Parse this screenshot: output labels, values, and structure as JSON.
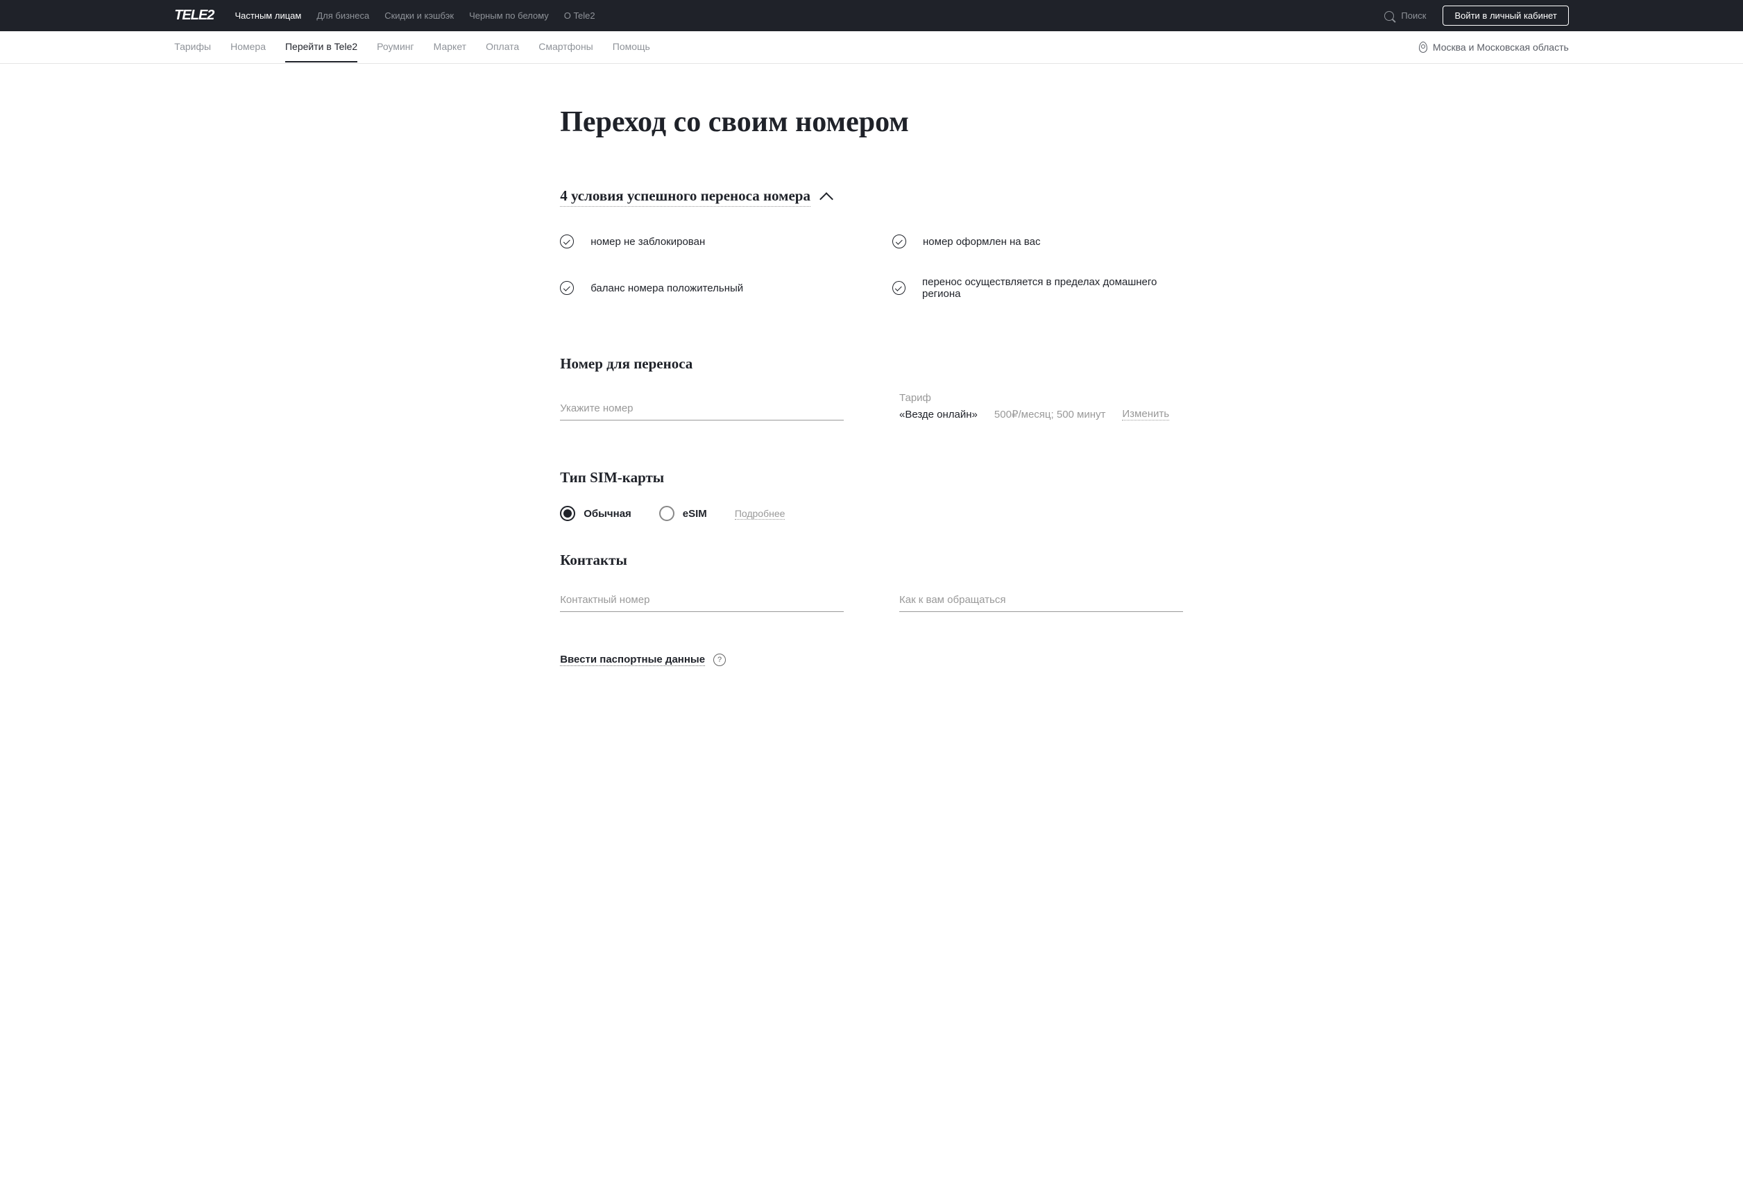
{
  "header": {
    "logo": "TELE2",
    "top_nav": [
      "Частным лицам",
      "Для бизнеса",
      "Скидки и кэшбэк",
      "Черным по белому",
      "О Tele2"
    ],
    "top_nav_active": 0,
    "search_label": "Поиск",
    "login_label": "Войти в личный кабинет"
  },
  "nav": {
    "items": [
      "Тарифы",
      "Номера",
      "Перейти в Tele2",
      "Роуминг",
      "Маркет",
      "Оплата",
      "Смартфоны",
      "Помощь"
    ],
    "active": 2,
    "region": "Москва и Московская область"
  },
  "page": {
    "title": "Переход со своим номером",
    "conditions_header": "4 условия успешного переноса номера",
    "conditions": [
      "номер не заблокирован",
      "номер оформлен на вас",
      "баланс номера положительный",
      "перенос осуществляется в пределах домашнего региона"
    ]
  },
  "form": {
    "number_heading": "Номер для переноса",
    "number_placeholder": "Укажите номер",
    "tariff_label": "Тариф",
    "tariff_name": "«Везде онлайн»",
    "tariff_price": "500₽/месяц; 500 минут",
    "change_label": "Изменить",
    "sim_heading": "Тип SIM-карты",
    "sim_options": [
      {
        "label": "Обычная",
        "checked": true
      },
      {
        "label": "eSIM",
        "checked": false
      }
    ],
    "more_link": "Подробнее",
    "contacts_heading": "Контакты",
    "contact_phone_placeholder": "Контактный номер",
    "contact_name_placeholder": "Как к вам обращаться",
    "passport_link": "Ввести паспортные данные",
    "help_symbol": "?"
  }
}
